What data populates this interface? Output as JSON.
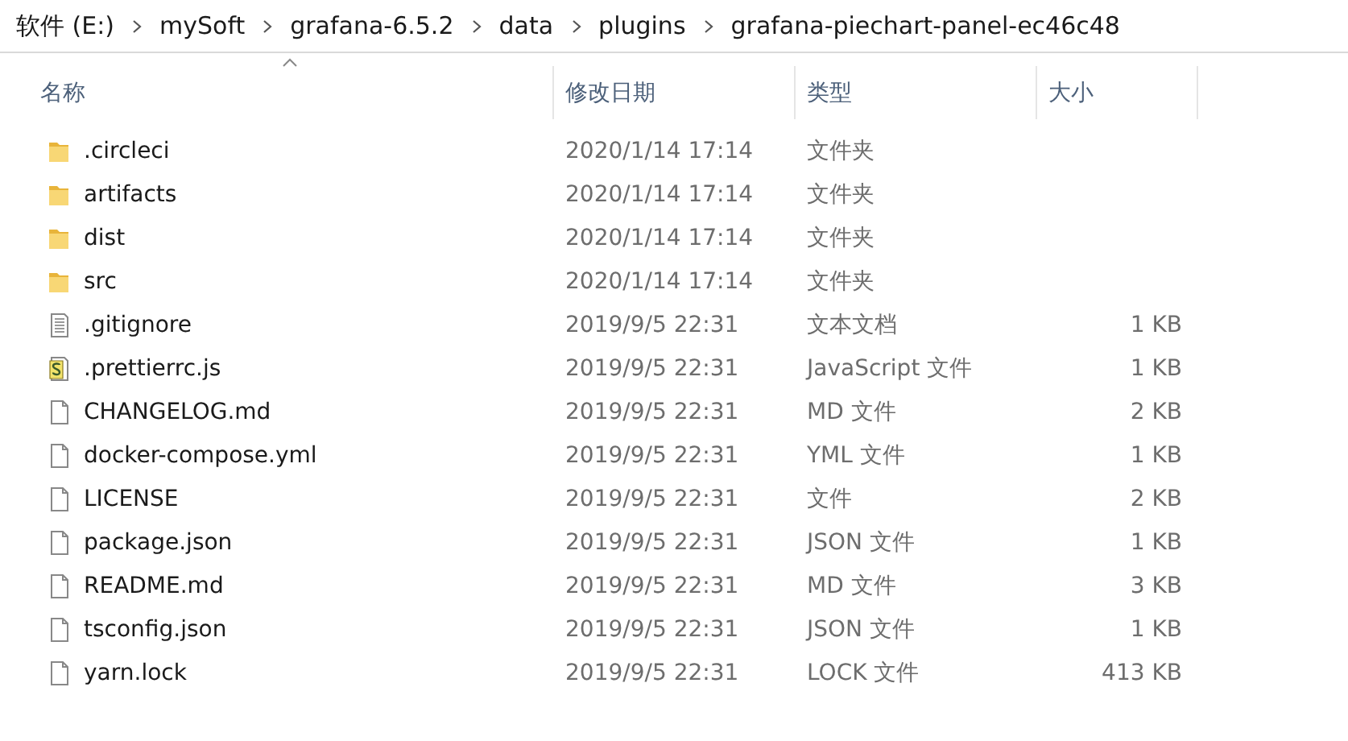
{
  "breadcrumb": [
    "软件 (E:)",
    "mySoft",
    "grafana-6.5.2",
    "data",
    "plugins",
    "grafana-piechart-panel-ec46c48"
  ],
  "columns": [
    {
      "label": "名称",
      "sorted": true
    },
    {
      "label": "修改日期",
      "sorted": false
    },
    {
      "label": "类型",
      "sorted": false
    },
    {
      "label": "大小",
      "sorted": false
    }
  ],
  "files": [
    {
      "kind": "folder",
      "name": ".circleci",
      "modified": "2020/1/14 17:14",
      "type": "文件夹"
    },
    {
      "kind": "folder",
      "name": "artifacts",
      "modified": "2020/1/14 17:14",
      "type": "文件夹"
    },
    {
      "kind": "folder",
      "name": "dist",
      "modified": "2020/1/14 17:14",
      "type": "文件夹"
    },
    {
      "kind": "folder",
      "name": "src",
      "modified": "2020/1/14 17:14",
      "type": "文件夹"
    },
    {
      "kind": "text",
      "name": ".gitignore",
      "modified": "2019/9/5 22:31",
      "type": "文本文档",
      "size": "1 KB"
    },
    {
      "kind": "script",
      "name": ".prettierrc.js",
      "modified": "2019/9/5 22:31",
      "type": "JavaScript 文件",
      "size": "1 KB"
    },
    {
      "kind": "file",
      "name": "CHANGELOG.md",
      "modified": "2019/9/5 22:31",
      "type": "MD 文件",
      "size": "2 KB"
    },
    {
      "kind": "file",
      "name": "docker-compose.yml",
      "modified": "2019/9/5 22:31",
      "type": "YML 文件",
      "size": "1 KB"
    },
    {
      "kind": "file",
      "name": "LICENSE",
      "modified": "2019/9/5 22:31",
      "type": "文件",
      "size": "2 KB"
    },
    {
      "kind": "file",
      "name": "package.json",
      "modified": "2019/9/5 22:31",
      "type": "JSON 文件",
      "size": "1 KB"
    },
    {
      "kind": "file",
      "name": "README.md",
      "modified": "2019/9/5 22:31",
      "type": "MD 文件",
      "size": "3 KB"
    },
    {
      "kind": "file",
      "name": "tsconfig.json",
      "modified": "2019/9/5 22:31",
      "type": "JSON 文件",
      "size": "1 KB"
    },
    {
      "kind": "file",
      "name": "yarn.lock",
      "modified": "2019/9/5 22:31",
      "type": "LOCK 文件",
      "size": "413 KB"
    }
  ]
}
